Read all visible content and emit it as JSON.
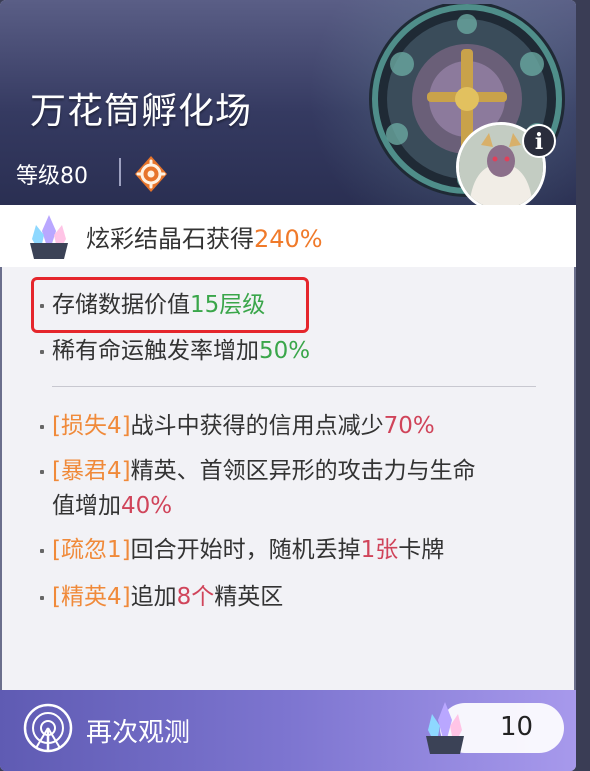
{
  "header": {
    "title": "万花筒孵化场",
    "level": "等级80",
    "info_label": "i"
  },
  "reward": {
    "label": "炫彩结晶石获得",
    "value": "240%"
  },
  "effects": [
    {
      "text": "存储数据价值",
      "value": "15层级",
      "highlighted": true
    },
    {
      "text": "稀有命运触发率增加",
      "value": "50%"
    }
  ],
  "modifiers": [
    {
      "tag": "[损失4]",
      "text": "战斗中获得的信用点减少",
      "value": "70%",
      "suffix": ""
    },
    {
      "tag": "[暴君4]",
      "text": "精英、首领区异形的攻击力与生命",
      "text2": "值增加",
      "value": "40%",
      "suffix": ""
    },
    {
      "tag": "[疏忽1]",
      "text": "回合开始时，随机丢掉",
      "value": "1张",
      "suffix": "卡牌"
    },
    {
      "tag": "[精英4]",
      "text": "追加",
      "value": "8个",
      "suffix": "精英区"
    }
  ],
  "footer": {
    "action_label": "再次观测",
    "cost": "10"
  },
  "colors": {
    "accent_orange": "#f07a2a",
    "accent_green": "#3aa64a",
    "accent_red": "#d0445a",
    "highlight_box": "#e5262c"
  }
}
